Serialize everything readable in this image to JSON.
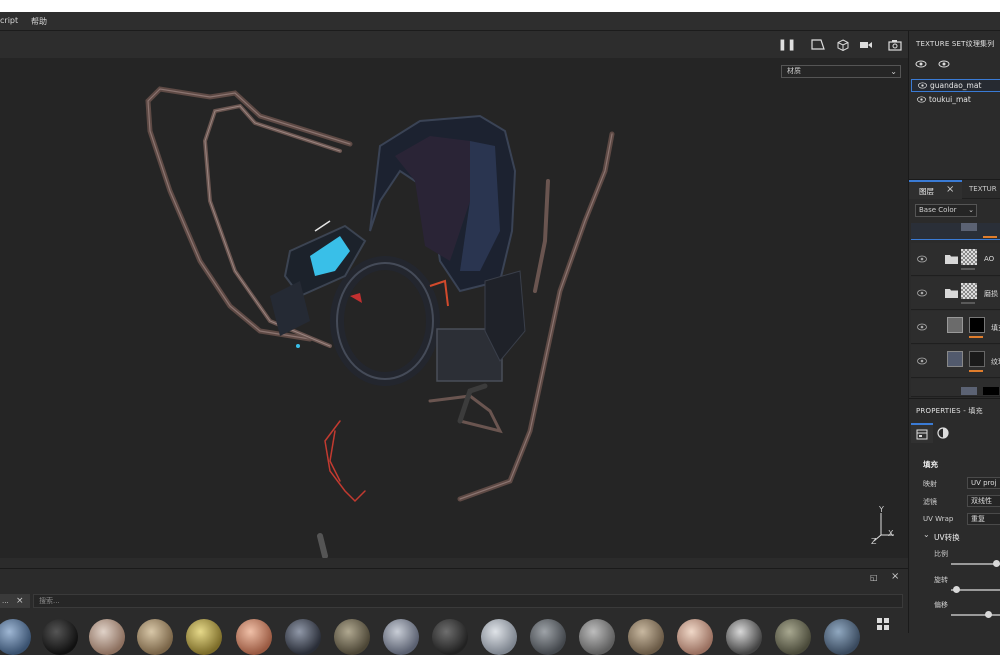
{
  "menubar": {
    "items": [
      "cript",
      "帮助"
    ]
  },
  "viewport": {
    "material_select": {
      "value": "材质"
    }
  },
  "axes": {
    "y": "Y",
    "x": "X",
    "z": "Z"
  },
  "texture_set": {
    "title": "TEXTURE SET纹理集列",
    "items": [
      {
        "label": "guandao_mat",
        "selected": true
      },
      {
        "label": "toukui_mat",
        "selected": false
      }
    ]
  },
  "layers": {
    "tab_label": "图层",
    "tab2_label": "TEXTUR",
    "channel_select": "Base Color",
    "rows": [
      {
        "label": "AO",
        "type": "folder"
      },
      {
        "label": "磨损",
        "type": "folder"
      },
      {
        "label": "填充",
        "type": "fill"
      },
      {
        "label": "纹理",
        "type": "fill"
      }
    ]
  },
  "properties": {
    "title": "PROPERTIES - 填充",
    "section": "填充",
    "fields": [
      {
        "label": "映射",
        "value": "UV proj"
      },
      {
        "label": "滤镜",
        "value": "双线性"
      },
      {
        "label": "UV Wrap",
        "value": "重复"
      }
    ],
    "uv_section": "UV转换",
    "sliders": [
      {
        "label": "比例",
        "value": 1.0
      },
      {
        "label": "旋转",
        "value": 0.0
      },
      {
        "label": "偏移",
        "value": 0.7
      }
    ]
  },
  "shelf": {
    "tab_label": "...",
    "search_placeholder": "搜索..."
  },
  "colors": {
    "accent_blue": "#3a7bd5",
    "orange": "#e07d2c",
    "viewport_bg": "#252525"
  }
}
